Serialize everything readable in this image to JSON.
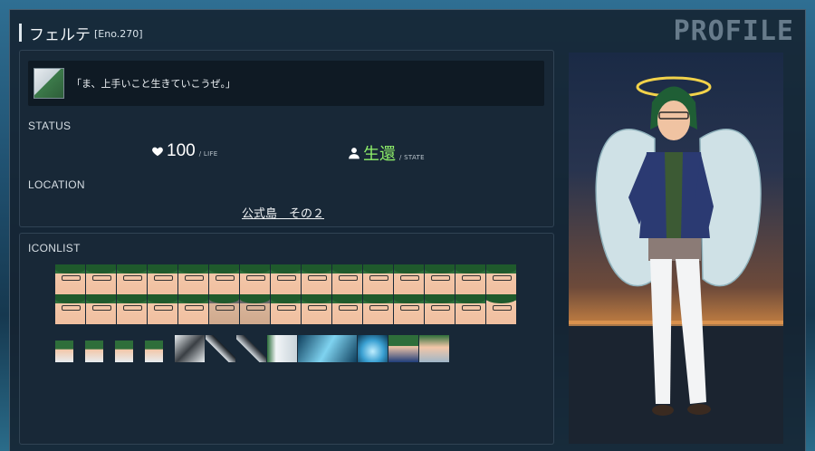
{
  "header": {
    "character_name": "フェルテ",
    "eno": "[Eno.270]",
    "profile_label": "PROFILE"
  },
  "quote": {
    "text": "「ま、上手いこと生きていこうぜ。」"
  },
  "status": {
    "label": "STATUS",
    "life_value": "100",
    "life_unit": "/ LIFE",
    "state_value": "生還",
    "state_unit": "/ STATE",
    "state_color": "#8ff06a"
  },
  "location": {
    "label": "LOCATION",
    "value": "公式島　その２"
  },
  "iconlist": {
    "label": "ICONLIST",
    "row1_count": 15,
    "row2_count": 15,
    "row3_icons": [
      "mini-face-1",
      "mini-face-2",
      "mini-face-3",
      "mini-face-4",
      "scythe-icon",
      "sword-icon",
      "blade-icon",
      "wing-icon",
      "wave-icon",
      "splash-icon",
      "chibi-icon",
      "chibi-wing-icon"
    ]
  },
  "portrait": {
    "alt": "character-portrait"
  }
}
